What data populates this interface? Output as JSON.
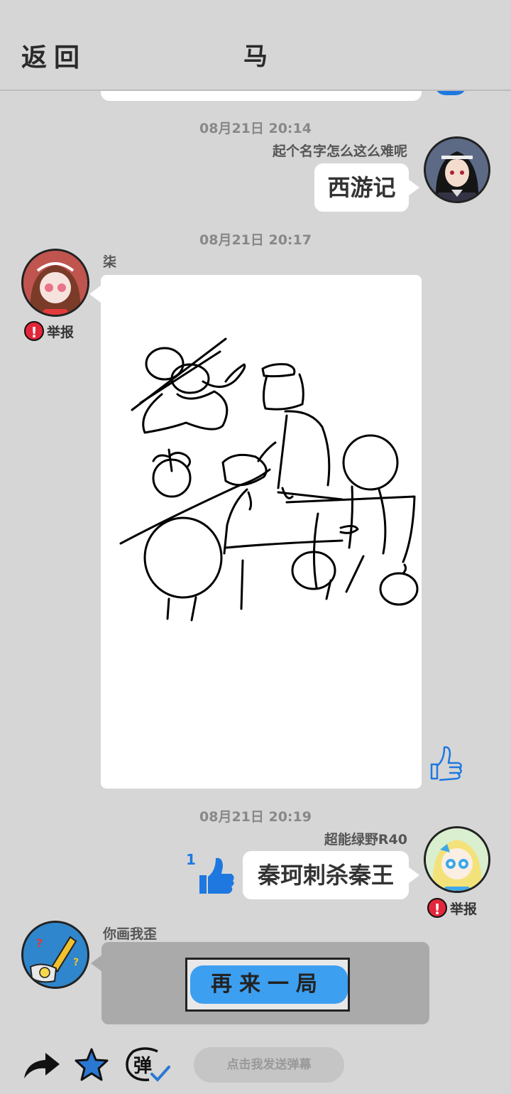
{
  "header": {
    "back_label": "返回",
    "title": "马"
  },
  "messages": [
    {
      "time": "08月21日  20:14",
      "user": "起个名字怎么这么难呢",
      "text": "西游记"
    },
    {
      "time": "08月21日  20:17",
      "user": "柒",
      "report": "举报"
    },
    {
      "time": "08月21日  20:19",
      "user": "超能绿野R40",
      "text": "秦珂刺杀秦王",
      "likes": "1",
      "report": "举报"
    },
    {
      "user": "你画我歪",
      "button_label": "再来一局"
    }
  ],
  "bottom": {
    "danmu_placeholder": "点击我发送弹幕",
    "danmu_icon_text": "弹"
  },
  "colors": {
    "background": "#d6d6d6",
    "like_blue": "#1e78e0",
    "report_red": "#e3263a",
    "button_blue": "#3d9ff0"
  }
}
